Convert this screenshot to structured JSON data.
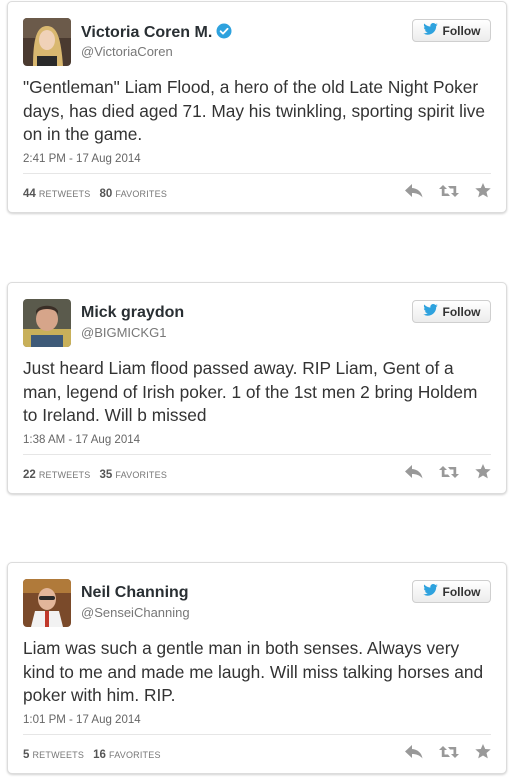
{
  "follow_label": "Follow",
  "colors": {
    "twitter_blue": "#2ea2de",
    "action_gray": "#999999"
  },
  "tweets": [
    {
      "name": "Victoria Coren M.",
      "verified": true,
      "handle": "@VictoriaCoren",
      "text": "\"Gentleman\" Liam Flood, a hero of the old Late Night Poker days, has died aged 71. May his twinkling, sporting spirit live on in the game.",
      "time": "2:41 PM - 17 Aug 2014",
      "retweets": "44",
      "retweets_label": "RETWEETS",
      "favorites": "80",
      "favorites_label": "FAVORITES"
    },
    {
      "name": "Mick graydon",
      "verified": false,
      "handle": "@BIGMICKG1",
      "text": "Just heard Liam flood passed away. RIP Liam, Gent of a man, legend of Irish poker. 1 of the 1st men 2 bring Holdem to Ireland. Will b missed",
      "time": "1:38 AM - 17 Aug 2014",
      "retweets": "22",
      "retweets_label": "RETWEETS",
      "favorites": "35",
      "favorites_label": "FAVORITES"
    },
    {
      "name": "Neil Channing",
      "verified": false,
      "handle": "@SenseiChanning",
      "text": "Liam was such a gentle man in both senses. Always very kind to me and made me laugh. Will miss talking horses and poker with him. RIP.",
      "time": "1:01 PM - 17 Aug 2014",
      "retweets": "5",
      "retweets_label": "RETWEETS",
      "favorites": "16",
      "favorites_label": "FAVORITES"
    }
  ]
}
